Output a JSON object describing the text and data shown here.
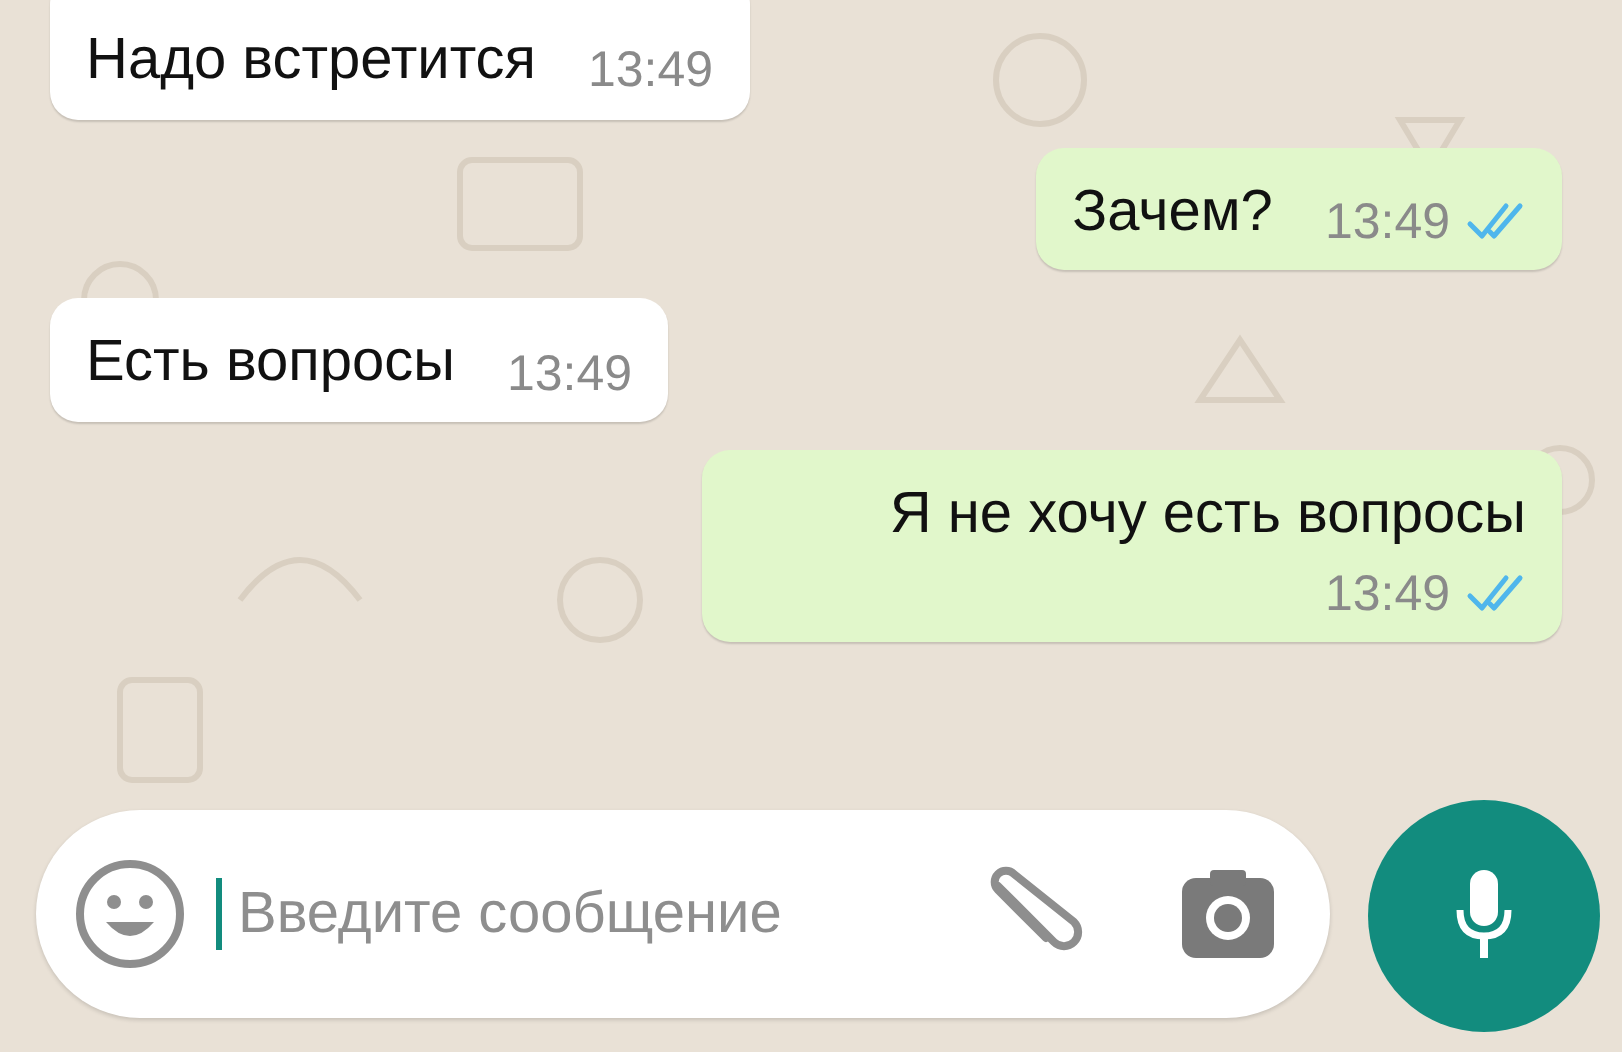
{
  "messages": [
    {
      "kind": "incoming",
      "text": "Надо встретится",
      "time": "13:49"
    },
    {
      "kind": "outgoing",
      "text": "Зачем?",
      "time": "13:49",
      "read": true
    },
    {
      "kind": "incoming",
      "text": "Есть вопросы",
      "time": "13:49"
    },
    {
      "kind": "outgoing",
      "text": "Я не хочу есть вопросы",
      "time": "13:49",
      "read": true
    }
  ],
  "composer": {
    "placeholder": "Введите сообщение"
  }
}
